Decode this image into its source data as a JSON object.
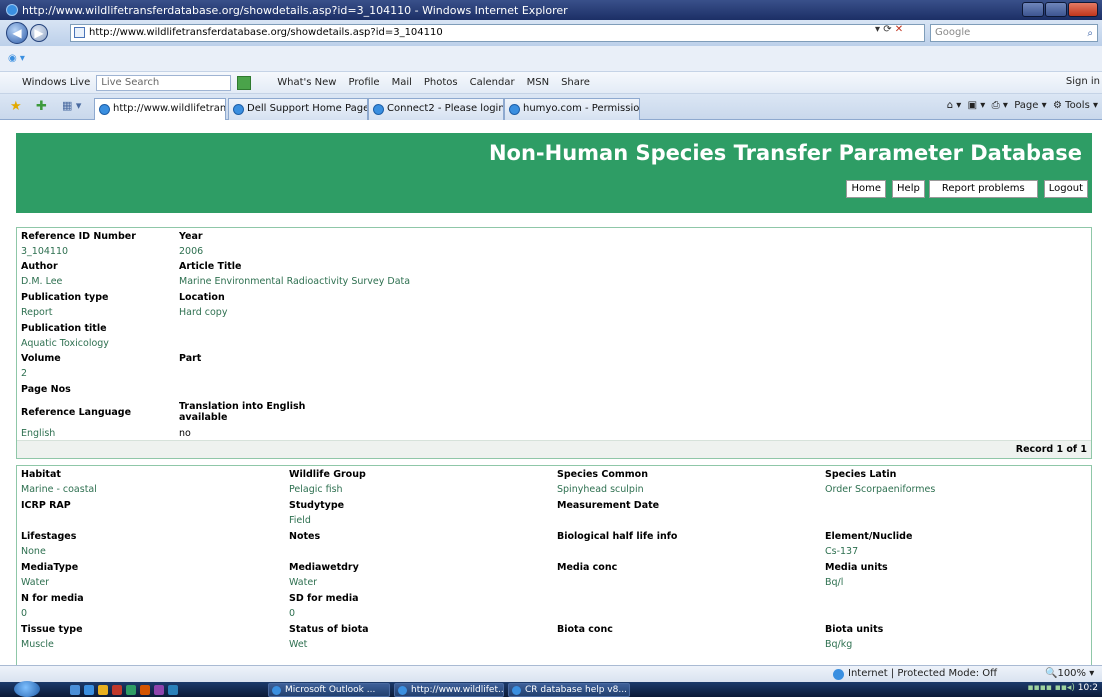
{
  "window": {
    "title": "http://www.wildlifetransferdatabase.org/showdetails.asp?id=3_104110 - Windows Internet Explorer"
  },
  "address": {
    "url": "http://www.wildlifetransferdatabase.org/showdetails.asp?id=3_104110",
    "search_placeholder": "Google"
  },
  "wl_toolbar": {
    "brand": "Windows Live",
    "search_placeholder": "Live Search",
    "links": [
      "What's New",
      "Profile",
      "Mail",
      "Photos",
      "Calendar",
      "MSN",
      "Share"
    ],
    "signin": "Sign in"
  },
  "tabs": [
    {
      "label": "http://www.wildlifetran...",
      "close": "X"
    },
    {
      "label": "Dell Support Home Page"
    },
    {
      "label": "Connect2 - Please login be..."
    },
    {
      "label": "humyo.com - Permission ..."
    }
  ],
  "commandbar": {
    "page": "Page",
    "tools": "Tools"
  },
  "header": {
    "title": "Non-Human Species Transfer Parameter Database",
    "buttons": [
      "Home",
      "Help",
      "Report problems",
      "Logout"
    ]
  },
  "reference": {
    "ref_id_label": "Reference ID Number",
    "ref_id": "3_104110",
    "year_label": "Year",
    "year": "2006",
    "author_label": "Author",
    "author": "D.M. Lee",
    "article_title_label": "Article Title",
    "article_title": "Marine Environmental Radioactivity Survey Data",
    "pub_type_label": "Publication type",
    "pub_type": "Report",
    "location_label": "Location",
    "location": "Hard copy",
    "pub_title_label": "Publication title",
    "pub_title": "Aquatic Toxicology",
    "volume_label": "Volume",
    "volume": "2",
    "part_label": "Part",
    "pages_label": "Page Nos",
    "language_label": "Reference Language",
    "language": "English",
    "translation_label_1": "Translation into English",
    "translation_label_2": "available",
    "translation": "no",
    "record": "Record 1 of 1"
  },
  "details": {
    "habitat_label": "Habitat",
    "habitat": "Marine - coastal",
    "wildlife_group_label": "Wildlife Group",
    "wildlife_group": "Pelagic fish",
    "species_common_label": "Species Common",
    "species_common": "Spinyhead sculpin",
    "species_latin_label": "Species Latin",
    "species_latin": "Order Scorpaeniformes",
    "icrp_label": "ICRP RAP",
    "studytype_label": "Studytype",
    "studytype": "Field",
    "measurement_date_label": "Measurement Date",
    "lifestages_label": "Lifestages",
    "lifestages": "None",
    "notes_label": "Notes",
    "half_life_label": "Biological half life info",
    "element_label": "Element/Nuclide",
    "element": "Cs-137",
    "media_type_label": "MediaType",
    "media_type": "Water",
    "mediawetdry_label": "Mediawetdry",
    "mediawetdry": "Water",
    "media_conc_label": "Media conc",
    "media_units_label": "Media units",
    "media_units": "Bq/l",
    "n_media_label": "N for media",
    "n_media": "0",
    "sd_media_label": "SD for media",
    "sd_media": "0",
    "tissue_label": "Tissue type",
    "tissue": "Muscle",
    "status_label": "Status of biota",
    "status": "Wet",
    "biota_conc_label": "Biota conc",
    "biota_units_label": "Biota units",
    "biota_units": "Bq/kg"
  },
  "status": {
    "zone": "Internet | Protected Mode: Off",
    "zoom": "100%"
  },
  "taskbar": {
    "items": [
      "Microsoft Outlook ...",
      "http://www.wildlifet...",
      "CR database help v8..."
    ],
    "clock": "10:2"
  }
}
